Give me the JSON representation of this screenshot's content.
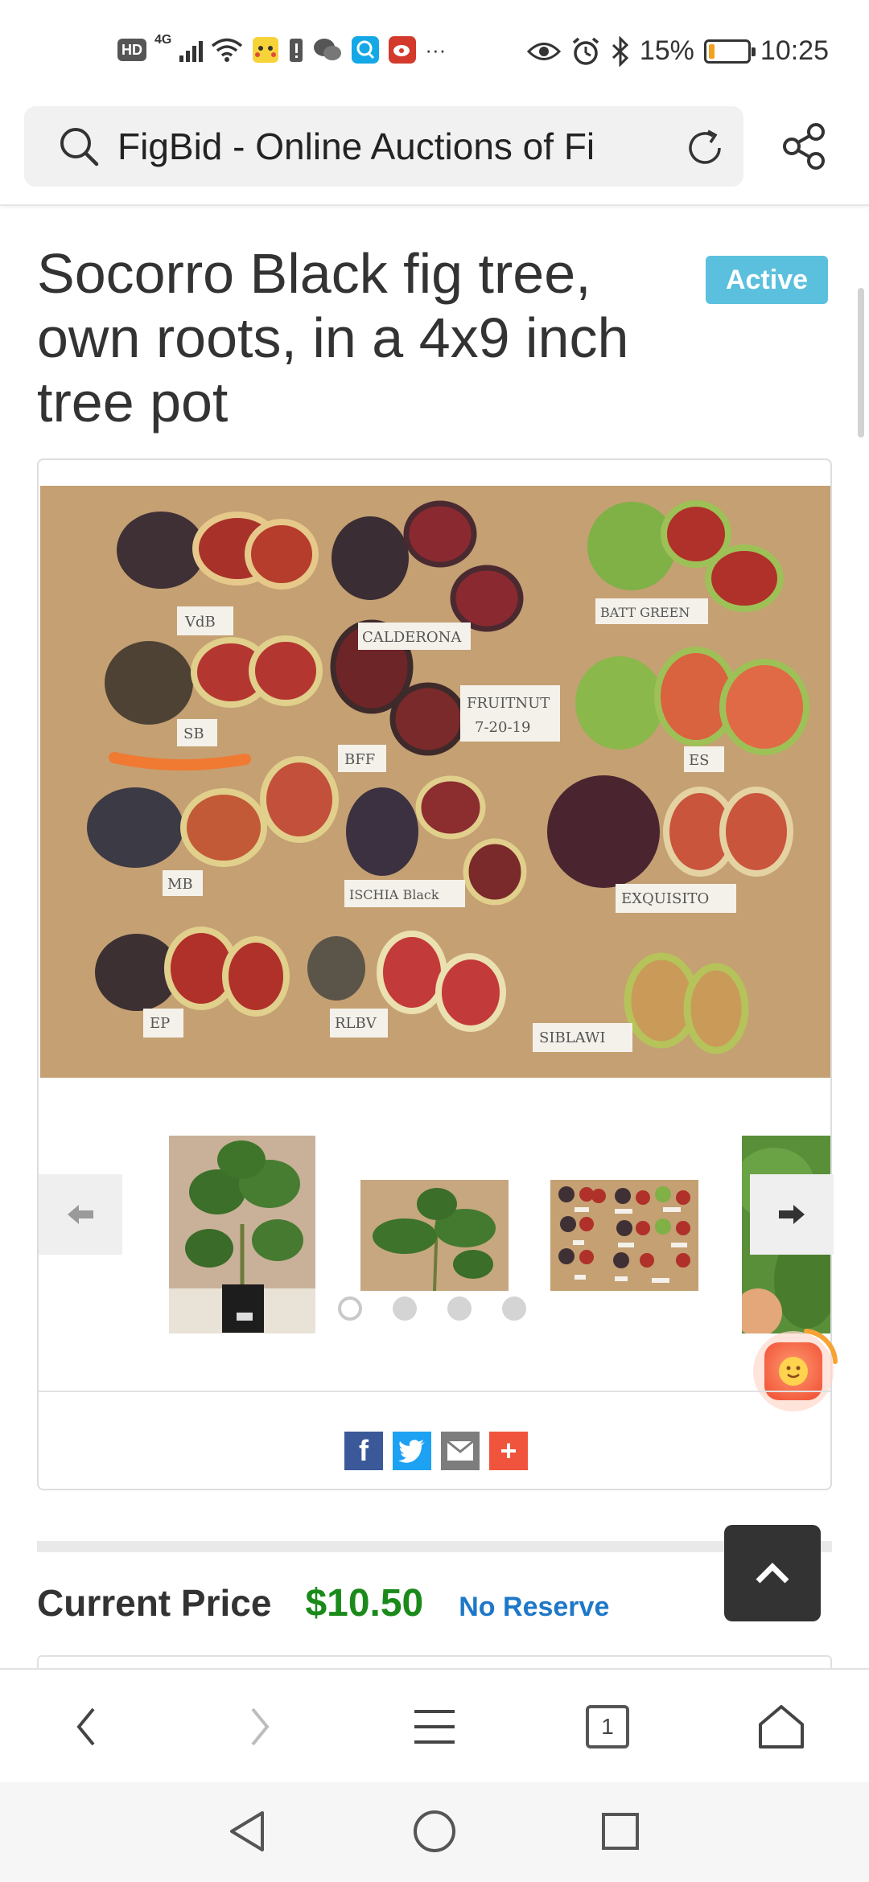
{
  "status_bar": {
    "hd_badge": "HD",
    "network": "4G",
    "battery_percent": "15%",
    "battery_level": 0.15,
    "time": "10:25",
    "more": "···"
  },
  "browser": {
    "url_text": "FigBid - Online Auctions of Fi"
  },
  "listing": {
    "title": "Socorro Black fig tree, own roots, in a 4x9 inch tree pot",
    "status": "Active"
  },
  "gallery": {
    "photo_labels": [
      "VdB",
      "CALDERONA",
      "BATT GREEN",
      "SB",
      "BFF",
      "FRUITNUT",
      "7-20-19",
      "ES",
      "MB",
      "ISCHIA Black",
      "EXQUISITO",
      "EP",
      "RLBV",
      "SIBLAWI"
    ],
    "page_count": 4,
    "active_page": 0
  },
  "share": {
    "facebook": "f",
    "twitter": "twitter-icon",
    "email": "email-icon",
    "more": "+"
  },
  "price": {
    "label": "Current Price",
    "value": "$10.50",
    "reserve": "No Reserve"
  },
  "browser_nav": {
    "tab_count": "1"
  },
  "colors": {
    "active_badge": "#5bc0de",
    "price_green": "#1a8a1a",
    "reserve_blue": "#1e78c8",
    "facebook": "#3b5998",
    "twitter": "#1da1f2",
    "email": "#7d7d7d",
    "share_more": "#f0543c"
  }
}
